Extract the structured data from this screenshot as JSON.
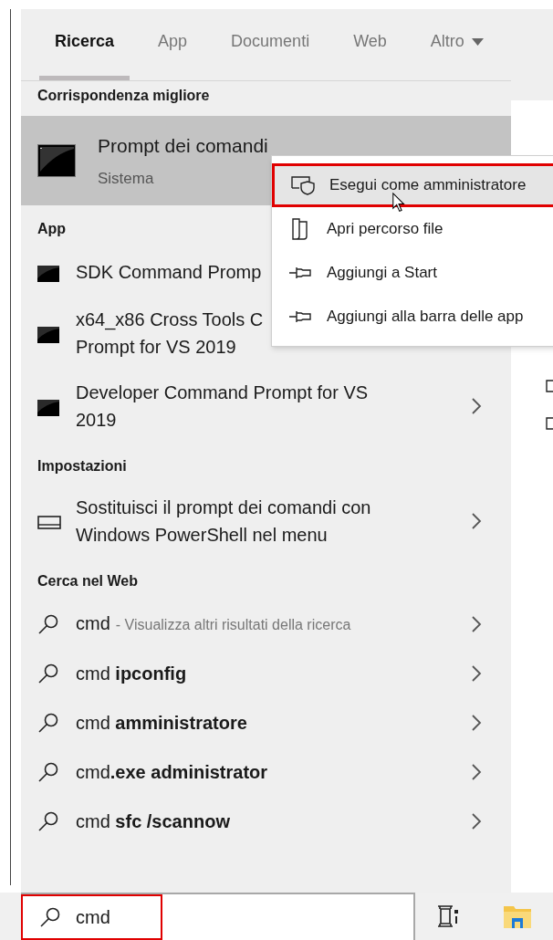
{
  "tabs": [
    {
      "label": "Ricerca",
      "selected": true,
      "dropdown": false
    },
    {
      "label": "App",
      "selected": false,
      "dropdown": false
    },
    {
      "label": "Documenti",
      "selected": false,
      "dropdown": false
    },
    {
      "label": "Web",
      "selected": false,
      "dropdown": false
    },
    {
      "label": "Altro",
      "selected": false,
      "dropdown": true
    }
  ],
  "best_match": {
    "heading": "Corrispondenza migliore",
    "title": "Prompt dei comandi",
    "subtitle": "Sistema",
    "selected": true
  },
  "sections": [
    {
      "heading": "App",
      "items": [
        {
          "kind": "app",
          "lines": [
            "SDK Command Promp"
          ]
        },
        {
          "kind": "app",
          "lines": [
            "x64_x86 Cross Tools C",
            "Prompt for VS 2019"
          ]
        },
        {
          "kind": "app",
          "lines": [
            "Developer Command Prompt for VS",
            "2019"
          ],
          "chevron": true
        }
      ]
    },
    {
      "heading": "Impostazioni",
      "items": [
        {
          "kind": "settings",
          "lines": [
            "Sostituisci il prompt dei comandi con",
            "Windows PowerShell nel menu"
          ],
          "chevron": true
        }
      ]
    },
    {
      "heading": "Cerca nel Web",
      "items": [
        {
          "kind": "web",
          "lines": [
            "cmd"
          ],
          "hint": "- Visualizza altri risultati della ricerca",
          "chevron": true
        },
        {
          "kind": "web",
          "lines": [
            "cmd **ipconfig**"
          ],
          "chevron": true
        },
        {
          "kind": "web",
          "lines": [
            "cmd **amministratore**"
          ],
          "chevron": true
        },
        {
          "kind": "web",
          "lines": [
            "cmd**.exe administrator**"
          ],
          "chevron": true
        },
        {
          "kind": "web",
          "lines": [
            "cmd **sfc /scannow**"
          ],
          "chevron": true
        }
      ]
    }
  ],
  "context_menu": {
    "items": [
      {
        "kind": "shield",
        "label": "Esegui come amministratore",
        "highlighted": true
      },
      {
        "kind": "folder",
        "label": "Apri percorso file",
        "highlighted": false
      },
      {
        "kind": "pin",
        "label": "Aggiungi a Start",
        "highlighted": false
      },
      {
        "kind": "pin",
        "label": "Aggiungi alla barra delle app",
        "highlighted": false
      }
    ]
  },
  "search": {
    "value": "cmd",
    "highlighted": true
  }
}
